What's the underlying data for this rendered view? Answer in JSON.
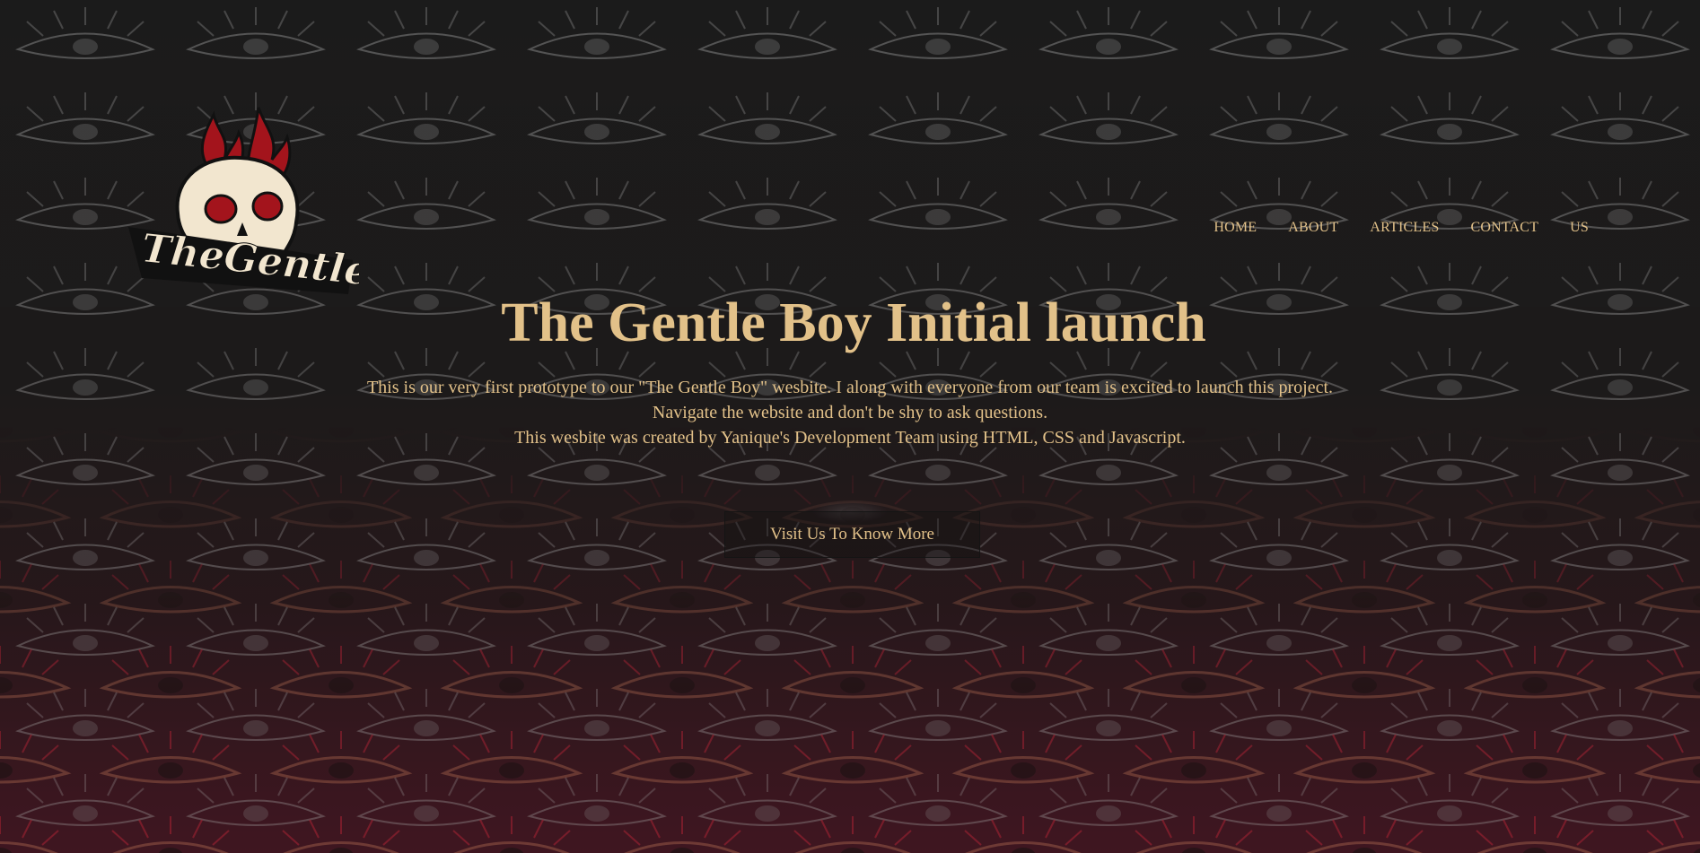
{
  "brand": {
    "logo_text": "TheGentleBoy"
  },
  "nav": {
    "items": [
      "HOME",
      "ABOUT",
      "ARTICLES",
      "CONTACT",
      "US"
    ]
  },
  "hero": {
    "title": "The Gentle Boy Initial launch",
    "lines": [
      "This is our very first prototype to our \"The Gentle Boy\" wesbite. I along with everyone from our team is excited to launch this project.",
      "Navigate the website and don't be shy to ask questions.",
      "This wesbite was created by Yanique's Development Team using HTML, CSS and Javascript."
    ],
    "cta_label": "Visit Us To Know More"
  },
  "colors": {
    "accent": "#e2c189",
    "background": "#1b1b1b",
    "flame": "#a3141c"
  }
}
